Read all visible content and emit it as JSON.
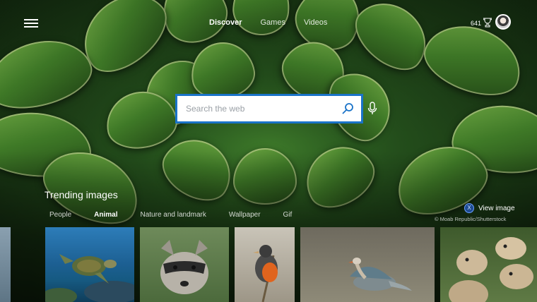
{
  "nav": {
    "tabs": [
      {
        "label": "Discover",
        "active": true
      },
      {
        "label": "Games",
        "active": false
      },
      {
        "label": "Videos",
        "active": false
      }
    ]
  },
  "account": {
    "points": "641"
  },
  "search": {
    "placeholder": "Search the web",
    "value": ""
  },
  "trending": {
    "title": "Trending images",
    "categories": [
      "People",
      "Animal",
      "Nature and landmark",
      "Wallpaper",
      "Gif"
    ],
    "active_category": "Animal",
    "view_image_label": "View image",
    "view_image_button": "X",
    "credit": "© Moab Republic/Shutterstock",
    "thumbnails": [
      "turtle",
      "raccoon",
      "bird",
      "goose",
      "prairie-dogs"
    ]
  },
  "colors": {
    "accent": "#1a73c8",
    "leaf": "#3f7a27"
  }
}
